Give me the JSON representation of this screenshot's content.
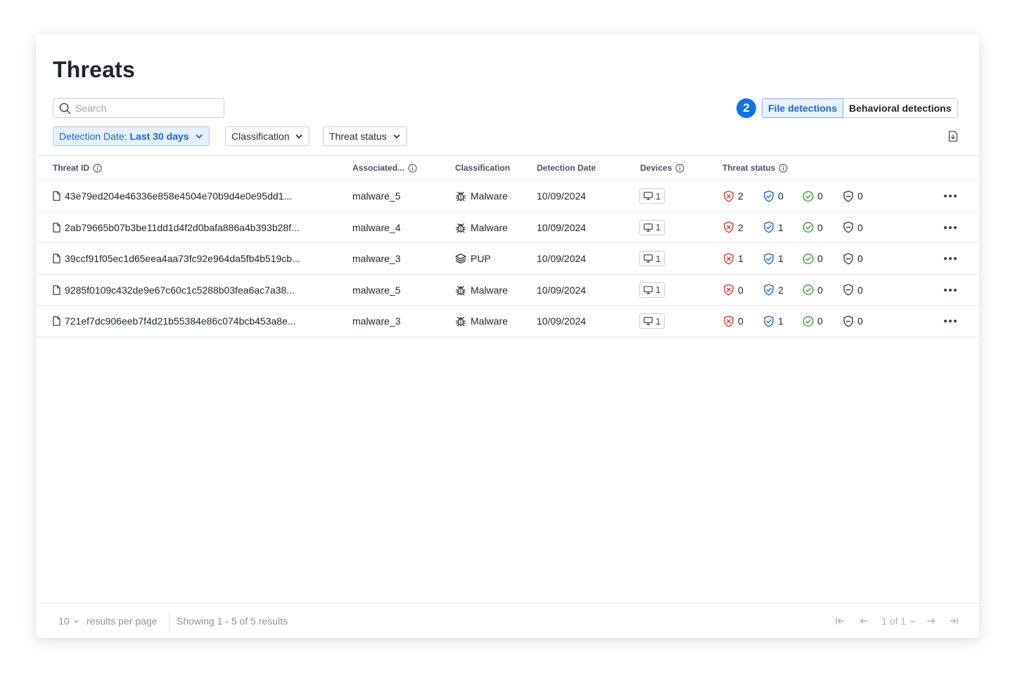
{
  "page": {
    "title": "Threats"
  },
  "search": {
    "placeholder": "Search"
  },
  "tabs": {
    "count": "2",
    "file_label": "File detections",
    "behavioral_label": "Behavioral detections"
  },
  "filters": {
    "date_prefix": "Detection Date:",
    "date_value": "Last 30 days",
    "classification": "Classification",
    "threat_status": "Threat status"
  },
  "table": {
    "headers": {
      "threat_id": "Threat ID",
      "associated": "Associated...",
      "classification": "Classification",
      "detection_date": "Detection Date",
      "devices": "Devices",
      "threat_status": "Threat status"
    },
    "rows": [
      {
        "id": "43e79ed204e46336e858e4504e70b9d4e0e95dd1...",
        "associated": "malware_5",
        "classification": "Malware",
        "class_icon": "bug-icon",
        "date": "10/09/2024",
        "devices": "1",
        "active": "2",
        "quarantined": "0",
        "resolved": "0",
        "other": "0"
      },
      {
        "id": "2ab79665b07b3be11dd1d4f2d0bafa886a4b393b28f...",
        "associated": "malware_4",
        "classification": "Malware",
        "class_icon": "bug-icon",
        "date": "10/09/2024",
        "devices": "1",
        "active": "2",
        "quarantined": "1",
        "resolved": "0",
        "other": "0"
      },
      {
        "id": "39ccf91f05ec1d65eea4aa73fc92e964da5fb4b519cb...",
        "associated": "malware_3",
        "classification": "PUP",
        "class_icon": "layers-icon",
        "date": "10/09/2024",
        "devices": "1",
        "active": "1",
        "quarantined": "1",
        "resolved": "0",
        "other": "0"
      },
      {
        "id": "9285f0109c432de9e67c60c1c5288b03fea6ac7a38...",
        "associated": "malware_5",
        "classification": "Malware",
        "class_icon": "bug-icon",
        "date": "10/09/2024",
        "devices": "1",
        "active": "0",
        "quarantined": "2",
        "resolved": "0",
        "other": "0"
      },
      {
        "id": "721ef7dc906eeb7f4d21b55384e86c074bcb453a8e...",
        "associated": "malware_3",
        "classification": "Malware",
        "class_icon": "bug-icon",
        "date": "10/09/2024",
        "devices": "1",
        "active": "0",
        "quarantined": "1",
        "resolved": "0",
        "other": "0"
      }
    ]
  },
  "footer": {
    "per_page": "10",
    "per_page_label": "results per page",
    "showing": "Showing 1 - 5 of 5 results",
    "page_indicator": "1 of 1"
  },
  "colors": {
    "accent": "#1273e6",
    "danger": "#d83b2f",
    "quarantine": "#1a66d2",
    "success": "#3a9a3a"
  }
}
